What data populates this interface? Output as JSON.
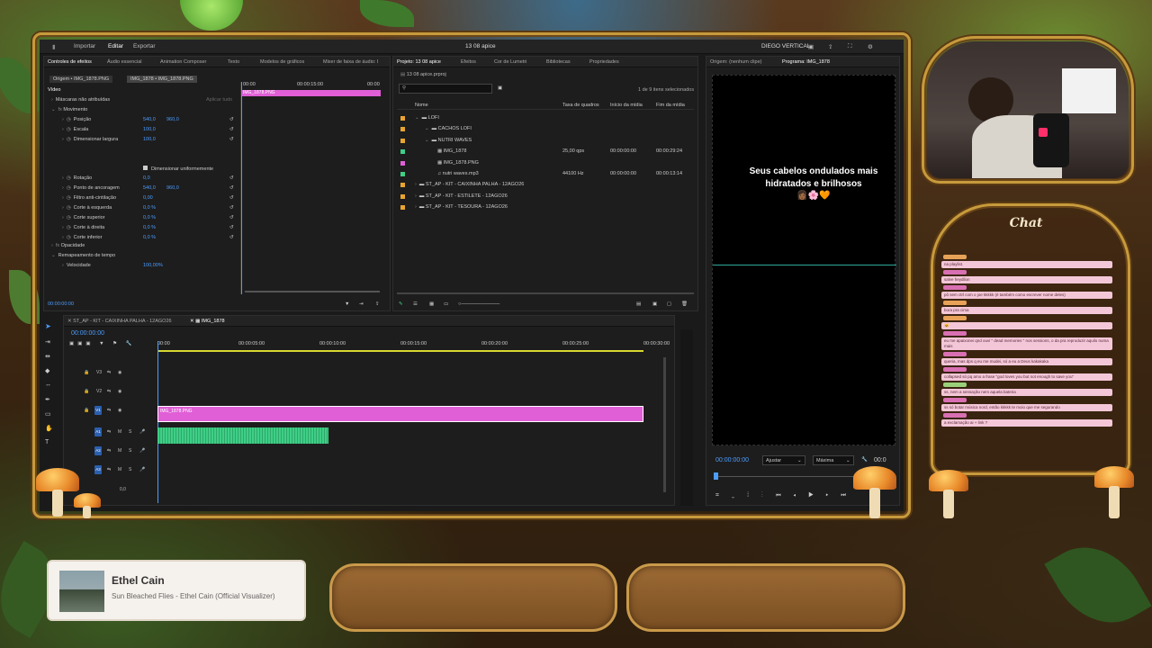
{
  "premiere": {
    "topbar": {
      "import_label": "Importar",
      "edit_label": "Editar",
      "export_label": "Exportar",
      "project_title": "13 08 apice",
      "workspace": "DIEGO VERTICAL"
    },
    "effects_panel": {
      "tabs": [
        "Controles de efeitos",
        "Áudio essencial",
        "Animation Composer",
        "Texto",
        "Modelos de gráficos",
        "Mixer de faixa de áudio: I"
      ],
      "source_label": "Origem • IMG_1878.PNG",
      "clip_label": "IMG_1878 • IMG_1878.PNG",
      "video_label": "Vídeo",
      "masks_label": "Máscaras não atribuídas",
      "apply_label": "Aplicar tudo",
      "motion_label": "Movimento",
      "props": [
        {
          "name": "Posição",
          "v1": "540,0",
          "v2": "960,0"
        },
        {
          "name": "Escala",
          "v1": "100,0",
          "v2": ""
        },
        {
          "name": "Dimensionar largura",
          "v1": "100,0",
          "v2": ""
        }
      ],
      "uniform_label": "Dimensionar uniformemente",
      "props2": [
        {
          "name": "Rotação",
          "v1": "0,0",
          "v2": ""
        },
        {
          "name": "Ponto de ancoragem",
          "v1": "540,0",
          "v2": "960,0"
        },
        {
          "name": "Filtro anti-cintilação",
          "v1": "0,00",
          "v2": ""
        },
        {
          "name": "Corte à esquerda",
          "v1": "0,0 %",
          "v2": ""
        },
        {
          "name": "Corte superior",
          "v1": "0,0 %",
          "v2": ""
        },
        {
          "name": "Corte à direita",
          "v1": "0,0 %",
          "v2": ""
        },
        {
          "name": "Corte inferior",
          "v1": "0,0 %",
          "v2": ""
        }
      ],
      "opacity_label": "Opacidade",
      "remap_label": "Remapeamento de tempo",
      "speed_label": "Velocidade",
      "speed_value": "100,00%",
      "mini_times": [
        "00:00",
        "00:00:15:00",
        "00:00"
      ],
      "mini_clip": "IMG_1878.PNG",
      "timecode": "00:00:00:00"
    },
    "project_panel": {
      "tabs": [
        "Projeto: 13 08 apice",
        "Efeitos",
        "Cor de Lumetri",
        "Bibliotecas",
        "Propriedades"
      ],
      "file": "13 08 apice.prproj",
      "count": "1 de 9 itens selecionados",
      "headers": [
        "Nome",
        "Taxa de quadros",
        "Início da mídia",
        "Fim da mídia"
      ],
      "items": [
        {
          "name": "LOFI",
          "rate": "",
          "start": "",
          "end": "",
          "color": "#e8a430",
          "indent": 0,
          "kind": "folder"
        },
        {
          "name": "CACHOS LOFI",
          "rate": "",
          "start": "",
          "end": "",
          "color": "#e8a430",
          "indent": 1,
          "kind": "folder"
        },
        {
          "name": "NUTRI WAVES",
          "rate": "",
          "start": "",
          "end": "",
          "color": "#e8a430",
          "indent": 1,
          "kind": "folder"
        },
        {
          "name": "IMG_1878",
          "rate": "25,00 qps",
          "start": "00:00:00:00",
          "end": "00:00:29:24",
          "color": "#3fcf86",
          "indent": 2,
          "kind": "seq"
        },
        {
          "name": "IMG_1878.PNG",
          "rate": "",
          "start": "",
          "end": "",
          "color": "#e05fd6",
          "indent": 2,
          "kind": "img"
        },
        {
          "name": "nutri waves.mp3",
          "rate": "44100 Hz",
          "start": "00:00:00:00",
          "end": "00:00:13:14",
          "color": "#3fcf86",
          "indent": 2,
          "kind": "audio"
        },
        {
          "name": "ST_AP - KIT - CAIXINHA PALHA - 12AGO26",
          "rate": "",
          "start": "",
          "end": "",
          "color": "#e8a430",
          "indent": 0,
          "kind": "folder"
        },
        {
          "name": "ST_AP - KIT - ESTILETE - 12AGO26",
          "rate": "",
          "start": "",
          "end": "",
          "color": "#e8a430",
          "indent": 0,
          "kind": "folder"
        },
        {
          "name": "ST_AP - KIT - TESOURA - 12AGO26",
          "rate": "",
          "start": "",
          "end": "",
          "color": "#e8a430",
          "indent": 0,
          "kind": "folder"
        }
      ]
    },
    "program": {
      "tabs": [
        "Origem: (nenhum clipe)",
        "Programa: IMG_1878"
      ],
      "caption": "Seus cabelos ondulados  mais hidratados e brilhosos",
      "emoji": "👩🏾🌸🧡",
      "timecode": "00:00:00:00",
      "fit": "Ajustar",
      "quality": "Máxima",
      "end_time": "00:0"
    },
    "timeline": {
      "tabs": [
        "ST_AP - KIT - CAIXINHA PALHA - 12AGO26",
        "IMG_1878"
      ],
      "timecode": "00:00:00:00",
      "ruler": [
        "00:00",
        "00:00:05:00",
        "00:00:10:00",
        "00:00:15:00",
        "00:00:20:00",
        "00:00:25:00",
        "00:00:30:00"
      ],
      "video_tracks": [
        "V3",
        "V2",
        "V1"
      ],
      "audio_tracks": [
        "A1",
        "A2",
        "A3"
      ],
      "clip_label": "IMG_1878.PNG",
      "mix_label": "Mix",
      "mix_value": "0,0"
    }
  },
  "chat": {
    "title": "Chat",
    "messages": [
      {
        "user": "o",
        "text": "na playlist."
      },
      {
        "user": "p",
        "text": "salve heydilon"
      },
      {
        "user": "p",
        "text": "pô sem ctrl com o joe kkkkk (é também como escrever nome deles)"
      },
      {
        "user": "o",
        "text": "bora pra cima"
      },
      {
        "user": "o",
        "text": "😺"
      },
      {
        "user": "p",
        "text": "eu me apaixonei qnd ouvi \" dead memories \" nos sessions, o da pra reproduzir aquilo numa mais"
      },
      {
        "user": "p",
        "text": "queria, mas dps q eu me mudei, só a eu a Deus kakakaka"
      },
      {
        "user": "p",
        "text": "collapsed só pq amo a frase \"god loves you but not enough to save you\""
      },
      {
        "user": "g",
        "text": "ss, nem a sensação nem aquela bateria"
      },
      {
        "user": "p",
        "text": "ss só botar música nord, então kkkkk te moio que me segurando"
      },
      {
        "user": "p",
        "text": "a exclamação ai + link ?"
      }
    ]
  },
  "now_playing": {
    "artist": "Ethel Cain",
    "track": "Sun Bleached Flies - Ethel Cain (Official Visualizer)"
  }
}
